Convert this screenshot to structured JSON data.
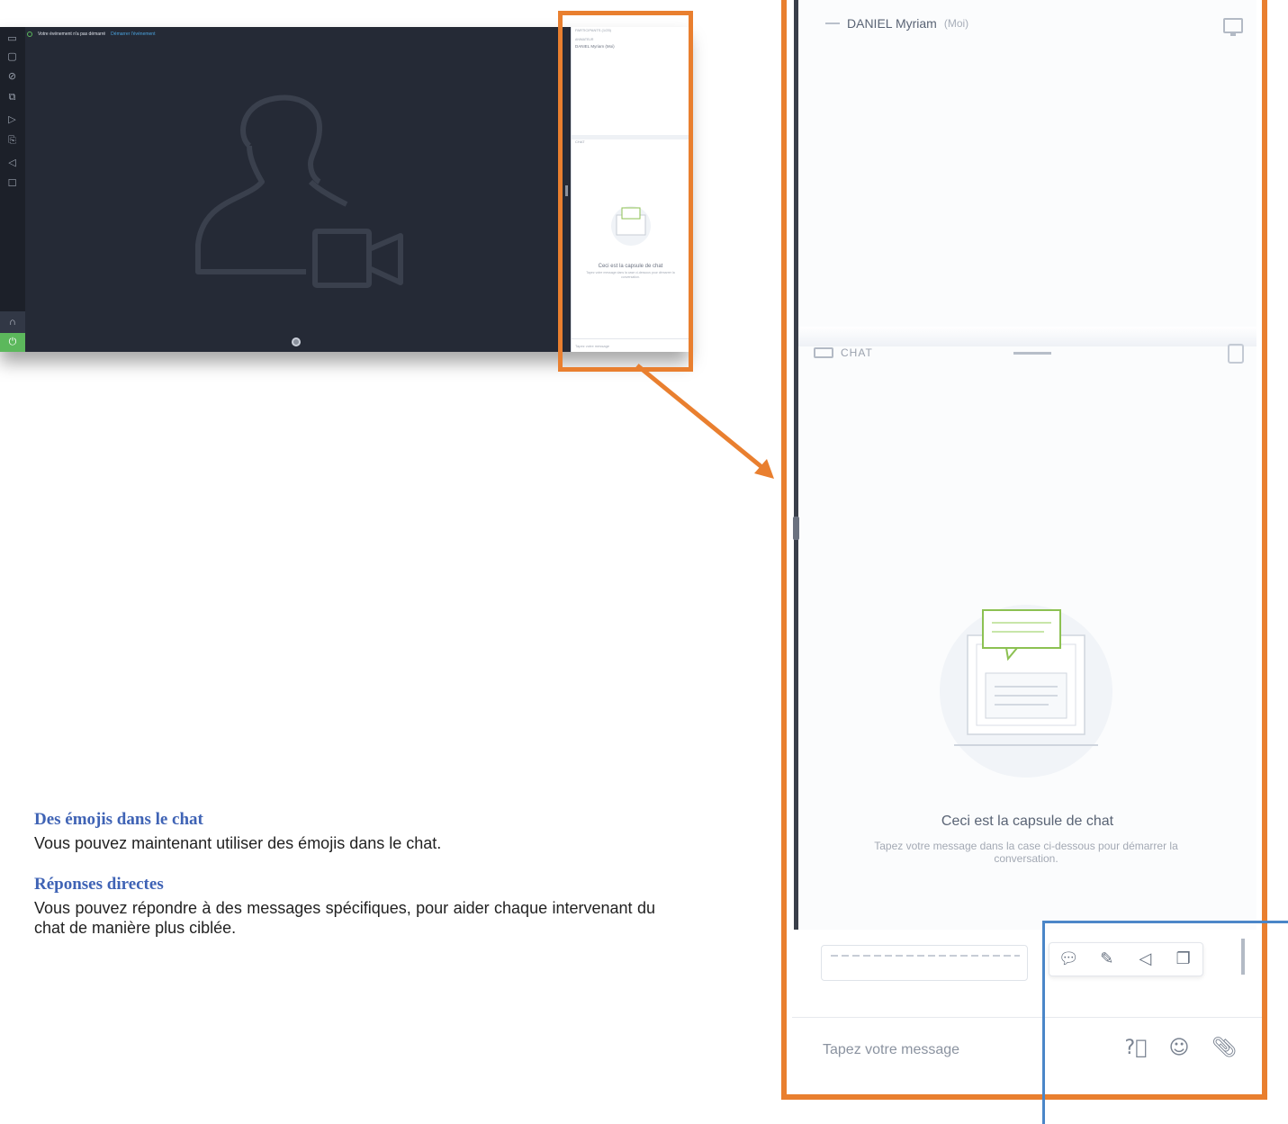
{
  "small_app": {
    "status_text": "Votre événement n'a pas démarré",
    "status_link": "Démarrer l'événement",
    "participants_header": "PARTICIPANTS (1/25)",
    "section_label": "ANIMATEUR",
    "user_name": "DANIEL Myriam",
    "user_tag": "(Moi)",
    "chat_label": "CHAT",
    "chat_title": "Ceci est la capsule de chat",
    "chat_subtitle": "Tapez votre message dans la case ci-dessous pour démarrer la conversation.",
    "input_placeholder": "Tapez votre message"
  },
  "zoom_panel": {
    "user_name": "DANIEL Myriam",
    "user_tag": "(Moi)",
    "chat_label": "CHAT",
    "chat_title": "Ceci est la capsule de chat",
    "chat_subtitle": "Tapez votre message dans la case ci-dessous pour démarrer la conversation.",
    "input_placeholder": "Tapez votre message"
  },
  "message_actions": [
    "reply-icon",
    "pin-icon",
    "announce-icon",
    "copy-icon"
  ],
  "input_actions": [
    "help-icon",
    "emoji-icon",
    "attach-icon"
  ],
  "text": {
    "heading_1": "Des émojis dans le chat",
    "body_1": "Vous pouvez maintenant utiliser des émojis dans le chat.",
    "heading_2": "Réponses directes",
    "body_2": "Vous pouvez répondre à des messages spécifiques, pour aider chaque intervenant du chat de manière plus ciblée."
  },
  "colors": {
    "highlight_orange": "#e97f2f",
    "highlight_blue": "#4a86c8",
    "heading_blue": "#3f63b5",
    "app_dark": "#252a36",
    "power_green": "#5cb85c"
  }
}
